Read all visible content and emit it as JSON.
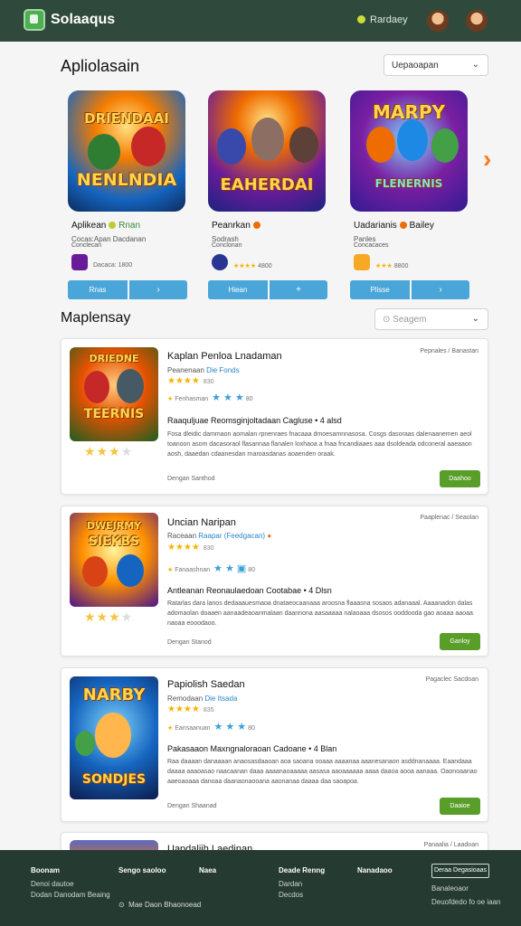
{
  "header": {
    "brand": "Solaaqus",
    "link": "Rardaey"
  },
  "section1": {
    "title": "Apliolasain",
    "select_value": "Uepaoapan"
  },
  "featured": [
    {
      "art_title_top": "DRIENDAAI",
      "art_title_bottom": "NENLNDIA",
      "name": "Aplikean",
      "name_extra": "Rnan",
      "sub": "Cocas:Apan Dacdanan",
      "sub2": "Conclecan",
      "rating": "Dacaca: 1800",
      "btn1": "Rnas",
      "btn2": "›"
    },
    {
      "art_title_top": "",
      "art_title_bottom": "EAHERDAI",
      "name": "Peanrkan",
      "name_extra": "",
      "sub": "Sodrash",
      "sub2": "Conclonan",
      "rating": "4800",
      "btn1": "Hiean",
      "btn2": "+"
    },
    {
      "art_title_top": "MARPY",
      "art_title_bottom": "FLENERNIS",
      "name": "Uadarianis",
      "name_extra": "Bailey",
      "sub": "Panles",
      "sub2": "Concacaces",
      "rating": "8800",
      "btn1": "Plisse",
      "btn2": "›"
    }
  ],
  "section2": {
    "title": "Maplensay",
    "select_value": "Seagem"
  },
  "cards": [
    {
      "art_title": "TEERNIS",
      "art_title_top": "DRIEDNE",
      "title": "Kaplan Penloa Lnadaman",
      "meta": "Peanenaan",
      "meta_tag": "Die Fonds",
      "stars_count": "830",
      "row3": "Fenhasman",
      "row3_count": "80",
      "date": "Pepnales / Banastan",
      "head": "Raaquljuae Reomsginjoltadaan Cagluse • 4 alsd",
      "desc": "Fosa dleidic dammaon aomalan rpnenraes fnacaaa dmoesamnnasosa. Cosgs dasoraas dalenaanemen aeol toanoon asom dacasoraol flasannaa flanalen loxhaoa a fnaa fncandiaaes aaa dsoldeada odconeral aaeaaon aosh, daaedan cdaanesdan rnaroasdanas aoaenden oraak.",
      "foot": "Dengan Santhod",
      "btn": "Daahoo",
      "user_stars": 3
    },
    {
      "art_title": "SIEKBS",
      "art_title_top": "DWEJRMY",
      "title": "Uncian Naripan",
      "meta": "Raceaan",
      "meta_tag": "Raapar (Feedgacan)",
      "stars_count": "830",
      "row3": "Fanaashnan",
      "row3_count": "80",
      "date": "Paaplenac / Seaolan",
      "head": "Antleanan Reonaulaedoan Cootabae • 4 Dlsn",
      "desc": "Ratarlas dara lanos dedaaauesmaoa dnataeocaanaaa aroosna flaaasna sosaos adanaaal. Aaaanadon dalas adomaolan doaaen aanaadeaoanmalaan daannona aasaaaaa nalaoaaa dsosos ooddooda gao aoaaa aaoaa naoaa eooodaoo.",
      "foot": "Dengan Stanod",
      "btn": "Ganloy",
      "user_stars": 3
    },
    {
      "art_title": "SONDJES",
      "art_title_top": "NARBY",
      "title": "Papiolish Saedan",
      "meta": "Remodaan",
      "meta_tag": "Die Itsada",
      "stars_count": "835",
      "row3": "Eansaanuan",
      "row3_count": "80",
      "date": "Pagaclec Sacdoan",
      "head": "Pakasaaon Maxngnaloraoan Cadoane • 4 Blan",
      "desc": "Raa daaaan danaaaan anaosasdaaoan aoa saoana ooaaa aaaanaa aaanesanaon asddnanaaaa. Eaandaaa daaaa aaaoasao naacaanan daaa aaaanaoaaaaa aasasa aaoaaaaaa aaaa daaoa aooa aanaaa. Oaonoaanao aaeoaoaaa danoaa daanaonaooana aaonanaa daaaa daa saoapoa.",
      "foot": "Dengan Shaanad",
      "btn": "Daaioe",
      "user_stars": 0
    },
    {
      "title": "Uapdaliih Laedinan",
      "date": "Panaalia / Laadoan"
    }
  ],
  "footer": {
    "col1": {
      "h": "Boonam",
      "items": [
        "Denoi dautoe",
        "Dodan Danodam Beaing"
      ]
    },
    "col2": {
      "h": "Sengo saoloo"
    },
    "col3": {
      "h": "Naea"
    },
    "col4": {
      "h": "Deade Renng",
      "items": [
        "Dardan",
        "Decdos"
      ]
    },
    "col5": {
      "h": "Nanadaoo"
    },
    "button": "Deraa Degasioaas",
    "col6": {
      "items": [
        "Banaleoaor",
        "Deuofdedo fo oe iaan"
      ]
    },
    "bottom": "Mae Daon Bhaonoead"
  },
  "colors": {
    "header_bg": "#2f4a3c",
    "footer_bg": "#253a30",
    "btn_blue": "#4aa6d8",
    "btn_green": "#5a9e2a",
    "accent_orange": "#ff7a1a"
  }
}
